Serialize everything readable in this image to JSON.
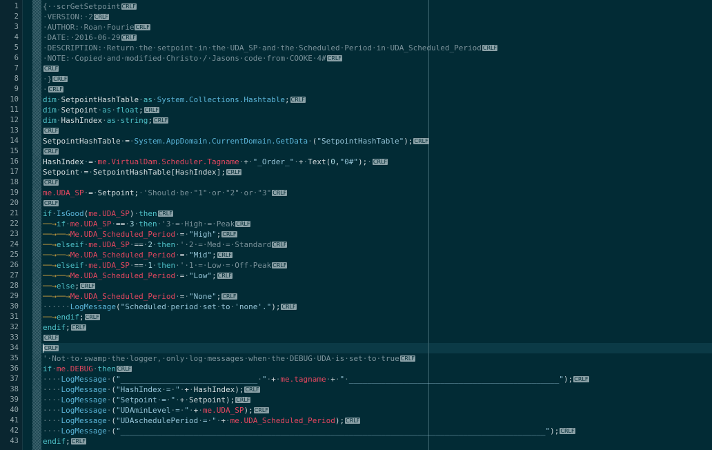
{
  "editor": {
    "eol_marker": "CRLF",
    "lines": [
      "{··scrGetSetpoint",
      "·VERSION:·2",
      "·AUTHOR:·Roan·Fourie",
      "·DATE:·2016-06-29",
      "·DESCRIPTION:·Return·the·setpoint·in·the·UDA_SP·and·the·Scheduled·Period·in·UDA_Scheduled_Period",
      "·NOTE:·Copied·and·modified·Christo·/·Jasons·code·from·COOKE·4#",
      "",
      "·}",
      "·",
      "dim·SetpointHashTable·as·System.Collections.Hashtable;",
      "dim·Setpoint·as·float;",
      "dim·HashIndex·as·string;",
      "",
      "SetpointHashTable·=·System.AppDomain.CurrentDomain.GetData·(\"SetpointHashTable\");",
      "",
      "HashIndex·=·me.VirtualDam.Scheduler.Tagname·+·\"_Order_\"·+·Text(0,\"0#\");·",
      "Setpoint·=·SetpointHashTable[HashIndex];",
      "",
      "me.UDA_SP·=·Setpoint;·'Should·be·\"1\"·or·\"2\"·or·\"3\"",
      "",
      "if·IsGood(me.UDA_SP)·then",
      "──→if·me.UDA_SP·==·3·then·'3·=·High·=·Peak",
      "──→──→Me.UDA_Scheduled_Period·=·\"High\";",
      "──→elseif·me.UDA_SP·==·2·then·'·2·=·Med·=·Standard",
      "──→──→Me.UDA_Scheduled_Period·=·\"Mid\";",
      "──→elseif·me.UDA_SP·==·1·then·'·1·=·Low·=·Off-Peak",
      "──→──→Me.UDA_Scheduled_Period·=·\"Low\";",
      "──→else;",
      "──→──→Me.UDA_Scheduled_Period·=·\"None\";",
      "······LogMessage(\"Scheduled·period·set·to·'none'.\");",
      "──→endif;",
      "endif;",
      "",
      "",
      "'·Not·to·swamp·the·logger,·only·log·messages·when·the·DEBUG·UDA·is·set·to·true",
      "if·me.DEBUG·then",
      "····LogMessage·(\"______________________________·\"·+·me.tagname·+·\"·______________________________________________\");",
      "····LogMessage·(\"HashIndex·=·\"·+·HashIndex);",
      "····LogMessage·(\"Setpoint·=·\"·+·Setpoint);",
      "····LogMessage·(\"UDAminLevel·=·\"·+·me.UDA_SP);",
      "····LogMessage·(\"UDAschedulePeriod·=·\"·+·me.UDA_Scheduled_Period);",
      "····LogMessage·(\"_____________________________________________________________________________________________\");",
      "endif;"
    ],
    "caret_line": 34,
    "colors": {
      "background": "#022b35",
      "keyword": "#4fc1c8",
      "type": "#5ab4d8",
      "member": "#e3475f",
      "string": "#94c3d6",
      "comment": "#7a929a",
      "tab_arrow": "#c39a3e"
    }
  }
}
